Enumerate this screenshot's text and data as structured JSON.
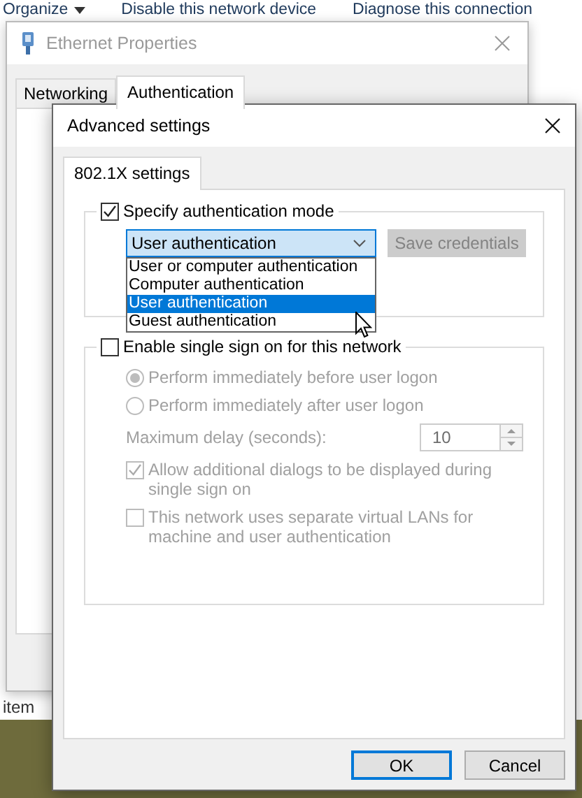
{
  "explorer": {
    "toolbar": [
      {
        "label": "Organize",
        "kind": "menu"
      },
      {
        "label": "Disable this network device",
        "kind": "plain"
      },
      {
        "label": "Diagnose this connection",
        "kind": "plain"
      }
    ],
    "status_text": "item"
  },
  "properties_window": {
    "title": "Ethernet Properties",
    "tabs": [
      {
        "label": "Networking",
        "selected": false
      },
      {
        "label": "Authentication",
        "selected": true
      }
    ]
  },
  "dialog": {
    "title": "Advanced settings",
    "tabs": [
      {
        "label": "802.1X settings",
        "selected": true
      }
    ],
    "auth_mode": {
      "label": "Specify authentication mode",
      "checked": true,
      "value": "User authentication",
      "expanded": true,
      "options": [
        {
          "label": "User or computer authentication",
          "selected": false
        },
        {
          "label": "Computer authentication",
          "selected": false
        },
        {
          "label": "User authentication",
          "selected": true
        },
        {
          "label": "Guest authentication",
          "selected": false
        }
      ],
      "save_button": {
        "label": "Save credentials",
        "disabled": true
      }
    },
    "sso": {
      "label": "Enable single sign on for this network",
      "checked": false,
      "radios": [
        {
          "label": "Perform immediately before user logon",
          "selected": true
        },
        {
          "label": "Perform immediately after user logon",
          "selected": false
        }
      ],
      "delay_label": "Maximum delay (seconds):",
      "delay_value": "10",
      "options": [
        {
          "label": "Allow additional dialogs to be displayed during single sign on",
          "checked": true
        },
        {
          "label": "This network uses separate virtual LANs for machine and user authentication",
          "checked": false
        }
      ]
    },
    "buttons": [
      {
        "label": "OK",
        "default": true
      },
      {
        "label": "Cancel",
        "default": false
      }
    ]
  }
}
